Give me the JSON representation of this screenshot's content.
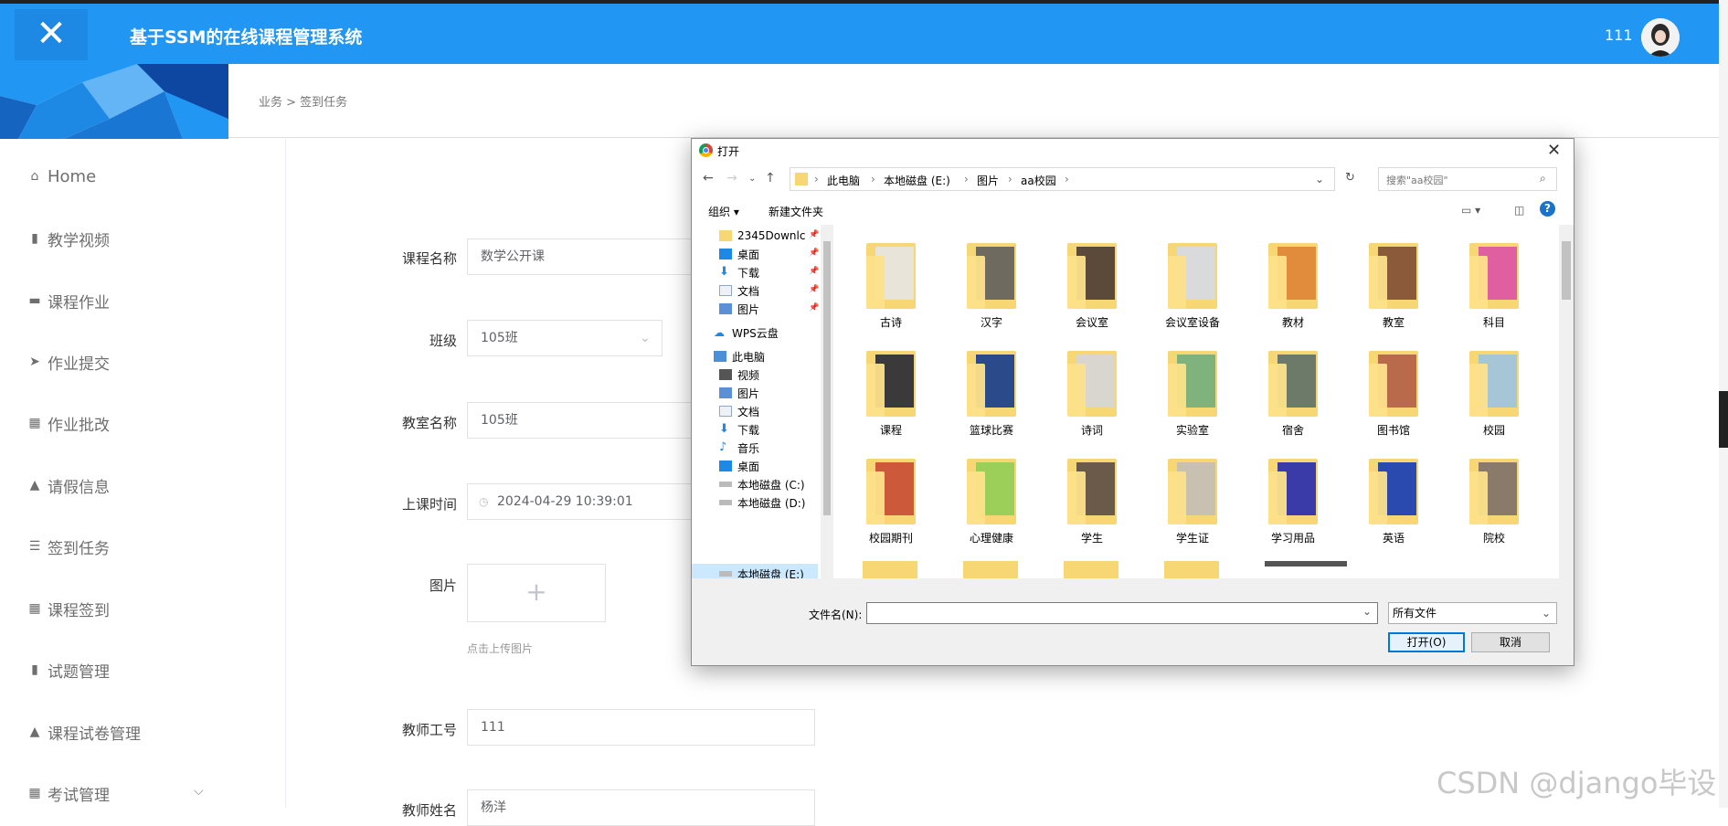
{
  "header": {
    "title": "基于SSM的在线课程管理系统",
    "close_glyph": "✕",
    "user": "111"
  },
  "sidebar": {
    "items": [
      {
        "label": "Home"
      },
      {
        "label": "教学视频"
      },
      {
        "label": "课程作业"
      },
      {
        "label": "作业提交"
      },
      {
        "label": "作业批改"
      },
      {
        "label": "请假信息"
      },
      {
        "label": "签到任务"
      },
      {
        "label": "课程签到"
      },
      {
        "label": "试题管理"
      },
      {
        "label": "课程试卷管理"
      },
      {
        "label": "考试管理"
      }
    ]
  },
  "breadcrumb": {
    "text": "业务 > 签到任务"
  },
  "form": {
    "course_label": "课程名称",
    "course_value": "数学公开课",
    "class_label": "班级",
    "class_value": "105班",
    "room_label": "教室名称",
    "room_value": "105班",
    "time_label": "上课时间",
    "time_value": "2024-04-29 10:39:01",
    "image_label": "图片",
    "upload_plus": "+",
    "upload_hint": "点击上传图片",
    "teacher_id_label": "教师工号",
    "teacher_id_value": "111",
    "teacher_name_label": "教师姓名",
    "teacher_name_value": "杨洋"
  },
  "dialog": {
    "title": "打开",
    "close": "✕",
    "path": [
      "此电脑",
      "本地磁盘 (E:)",
      "图片",
      "aa校园"
    ],
    "search_placeholder": "搜索\"aa校园\"",
    "toolbar": {
      "organize": "组织 ▾",
      "new_folder": "新建文件夹",
      "help": "?"
    },
    "tree": [
      {
        "label": "2345Downlc",
        "icon": "folder"
      },
      {
        "label": "桌面",
        "icon": "desktop"
      },
      {
        "label": "下载",
        "icon": "download"
      },
      {
        "label": "文档",
        "icon": "document"
      },
      {
        "label": "图片",
        "icon": "picture"
      },
      {
        "label": "WPS云盘",
        "icon": "cloud"
      },
      {
        "label": "此电脑",
        "icon": "computer"
      },
      {
        "label": "视频",
        "icon": "video"
      },
      {
        "label": "图片",
        "icon": "picture"
      },
      {
        "label": "文档",
        "icon": "document"
      },
      {
        "label": "下载",
        "icon": "download"
      },
      {
        "label": "音乐",
        "icon": "music"
      },
      {
        "label": "桌面",
        "icon": "desktop"
      },
      {
        "label": "本地磁盘 (C:)",
        "icon": "drive"
      },
      {
        "label": "本地磁盘 (D:)",
        "icon": "drive"
      },
      {
        "label": "本地磁盘 (E:)",
        "icon": "drive"
      }
    ],
    "files": [
      {
        "label": "古诗",
        "color": "#e9e4da"
      },
      {
        "label": "汉字",
        "color": "#6f6a60"
      },
      {
        "label": "会议室",
        "color": "#5b4a3a"
      },
      {
        "label": "会议室设备",
        "color": "#d8dadc"
      },
      {
        "label": "教材",
        "color": "#e18c3c"
      },
      {
        "label": "教室",
        "color": "#8b5a3a"
      },
      {
        "label": "科目",
        "color": "#e05fa0"
      },
      {
        "label": "课程",
        "color": "#3a3a3a"
      },
      {
        "label": "篮球比赛",
        "color": "#2a4a8a"
      },
      {
        "label": "诗词",
        "color": "#d9d6cf"
      },
      {
        "label": "实验室",
        "color": "#7fb27c"
      },
      {
        "label": "宿舍",
        "color": "#6d7a6a"
      },
      {
        "label": "图书馆",
        "color": "#b86a4a"
      },
      {
        "label": "校园",
        "color": "#a6c6d8"
      },
      {
        "label": "校园期刊",
        "color": "#cc5a3a"
      },
      {
        "label": "心理健康",
        "color": "#9ccf5a"
      },
      {
        "label": "学生",
        "color": "#6a5a4a"
      },
      {
        "label": "学生证",
        "color": "#c8c0b0"
      },
      {
        "label": "学习用品",
        "color": "#3a3aa8"
      },
      {
        "label": "英语",
        "color": "#2a4ab0"
      },
      {
        "label": "院校",
        "color": "#8a7a6a"
      }
    ],
    "filename_label": "文件名(N):",
    "filetype_value": "所有文件",
    "open_button": "打开(O)",
    "cancel_button": "取消"
  },
  "watermark": "CSDN @django毕设"
}
